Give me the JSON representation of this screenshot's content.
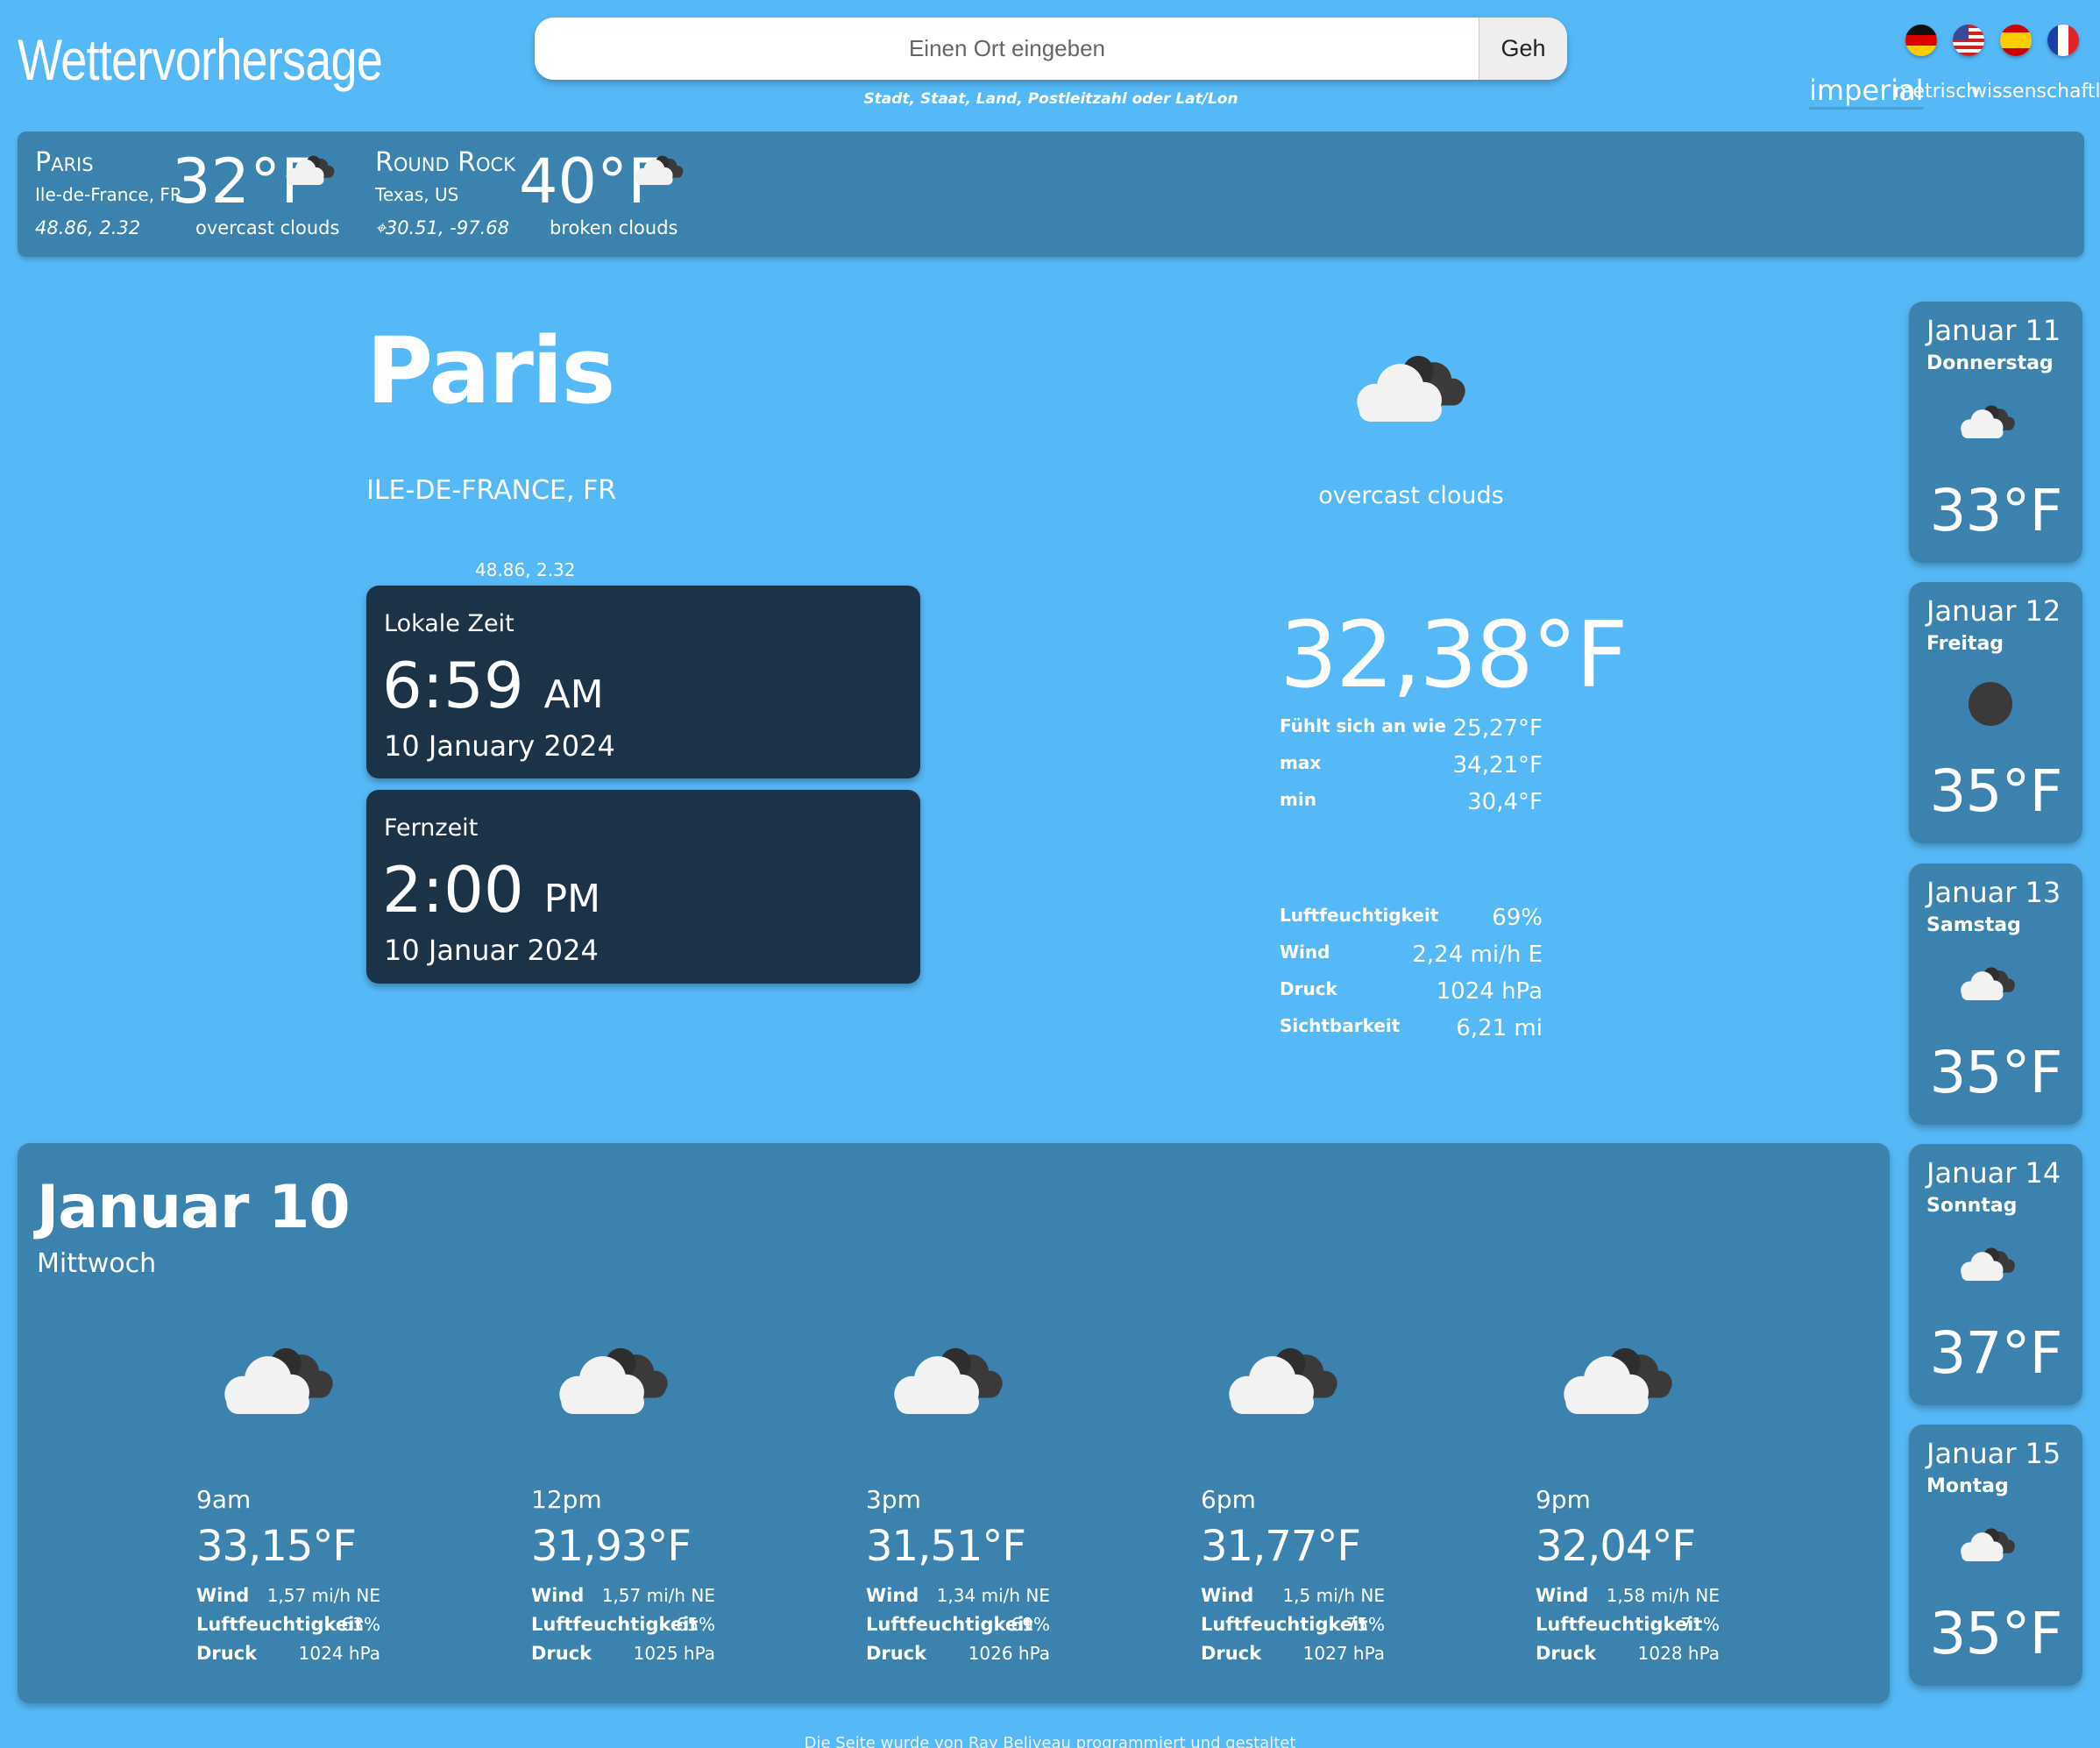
{
  "header": {
    "title": "Wettervorhersage",
    "search_placeholder": "Einen Ort eingeben",
    "search_value": "",
    "go_label": "Geh",
    "search_hint": "Stadt, Staat, Land, Postleitzahl oder Lat/Lon",
    "languages": [
      {
        "name": "de-flag-icon"
      },
      {
        "name": "us-flag-icon"
      },
      {
        "name": "es-flag-icon"
      },
      {
        "name": "fr-flag-icon"
      }
    ],
    "units": {
      "imperial": "imperial",
      "metric": "metrisch",
      "scientific": "wissenschaftlich",
      "selected": "imperial"
    }
  },
  "saved_locations": [
    {
      "name": "Paris",
      "region": "Ile-de-France, FR",
      "coords": "48.86, 2.32",
      "temp": "32°F",
      "description": "overcast clouds",
      "icon": "overcast-clouds-icon"
    },
    {
      "name": "Round Rock",
      "region": "Texas, US",
      "coords": "30.51, -97.68",
      "temp": "40°F",
      "description": "broken clouds",
      "icon": "broken-clouds-icon",
      "current_location": true
    }
  ],
  "current": {
    "city": "Paris",
    "region": "ILE-DE-FRANCE, FR",
    "coords": "48.86, 2.32",
    "local_time": {
      "label": "Lokale Zeit",
      "time": "6:59",
      "ampm": "AM",
      "date": "10 January 2024"
    },
    "remote_time": {
      "label": "Fernzeit",
      "time": "2:00",
      "ampm": "PM",
      "date": "10 Januar 2024"
    },
    "description": "overcast clouds",
    "icon": "overcast-clouds-icon",
    "temp": "32,38°F",
    "stats_top": [
      {
        "label": "Fühlt sich an wie",
        "value": "25,27°F"
      },
      {
        "label": "max",
        "value": "34,21°F"
      },
      {
        "label": "min",
        "value": "30,4°F"
      }
    ],
    "stats_bottom": [
      {
        "label": "Luftfeuchtigkeit",
        "value": "69%"
      },
      {
        "label": "Wind",
        "value": "2,24 mi/h E"
      },
      {
        "label": "Druck",
        "value": "1024 hPa"
      },
      {
        "label": "Sichtbarkeit",
        "value": "6,21 mi"
      }
    ]
  },
  "today": {
    "date": "Januar 10",
    "weekday": "Mittwoch",
    "labels": {
      "wind": "Wind",
      "humidity": "Luftfeuchtigkeit",
      "pressure": "Druck"
    },
    "hours": [
      {
        "time": "9am",
        "temp": "33,15°F",
        "wind": "1,57 mi/h NE",
        "humidity": "63%",
        "pressure": "1024 hPa"
      },
      {
        "time": "12pm",
        "temp": "31,93°F",
        "wind": "1,57 mi/h NE",
        "humidity": "65%",
        "pressure": "1025 hPa"
      },
      {
        "time": "3pm",
        "temp": "31,51°F",
        "wind": "1,34 mi/h NE",
        "humidity": "69%",
        "pressure": "1026 hPa"
      },
      {
        "time": "6pm",
        "temp": "31,77°F",
        "wind": "1,5 mi/h NE",
        "humidity": "75%",
        "pressure": "1027 hPa"
      },
      {
        "time": "9pm",
        "temp": "32,04°F",
        "wind": "1,58 mi/h NE",
        "humidity": "71%",
        "pressure": "1028 hPa"
      }
    ]
  },
  "forecast": [
    {
      "date": "Januar 11",
      "weekday": "Donnerstag",
      "temp": "33°F",
      "icon": "clouds-icon"
    },
    {
      "date": "Januar 12",
      "weekday": "Freitag",
      "temp": "35°F",
      "icon": "dark-circle-icon"
    },
    {
      "date": "Januar 13",
      "weekday": "Samstag",
      "temp": "35°F",
      "icon": "clouds-icon"
    },
    {
      "date": "Januar 14",
      "weekday": "Sonntag",
      "temp": "37°F",
      "icon": "clouds-icon"
    },
    {
      "date": "Januar 15",
      "weekday": "Montag",
      "temp": "35°F",
      "icon": "clouds-icon"
    }
  ],
  "footer": "Die Seite wurde von Ray Beliveau programmiert und gestaltet",
  "colors": {
    "background": "#56b9f7",
    "panel": "#3b82af",
    "time_card": "#1c3246"
  }
}
